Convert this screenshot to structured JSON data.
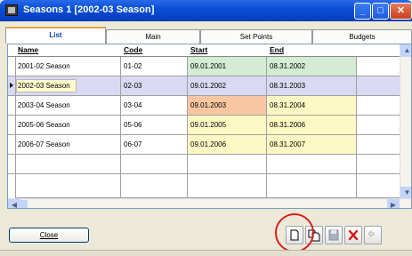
{
  "window": {
    "title": "Seasons  1 [2002-03 Season]",
    "minimize_glyph": "_",
    "maximize_glyph": "□",
    "close_glyph": "✕"
  },
  "tabs": [
    {
      "label": "List",
      "active": true
    },
    {
      "label": "Main",
      "active": false
    },
    {
      "label": "Set Points",
      "active": false
    },
    {
      "label": "Budgets",
      "active": false
    }
  ],
  "grid": {
    "columns": [
      "Name",
      "Code",
      "Start",
      "End"
    ],
    "rows": [
      {
        "name": "2001-02 Season",
        "code": "01-02",
        "start": "09.01.2001",
        "end": "08.31.2002"
      },
      {
        "name": "2002-03 Season",
        "code": "02-03",
        "start": "09.01.2002",
        "end": "08.31.2003",
        "current": true
      },
      {
        "name": "2003-04 Season",
        "code": "03-04",
        "start": "09.01.2003",
        "end": "08.31.2004"
      },
      {
        "name": "2005-06 Season",
        "code": "05-06",
        "start": "09.01.2005",
        "end": "08.31.2006"
      },
      {
        "name": "2006-07 Season",
        "code": "06-07",
        "start": "09.01.2006",
        "end": "08.31.2007"
      }
    ]
  },
  "colors": {
    "row_green": "#d3ecd3",
    "row_selected": "#d9d9f3",
    "row_orange": "#f8c7a2",
    "row_yellow": "#fcf8c4",
    "selected_name_highlight": "#fffdd0",
    "annotation_ring": "#d32020"
  },
  "footer": {
    "close_label": "Close"
  }
}
